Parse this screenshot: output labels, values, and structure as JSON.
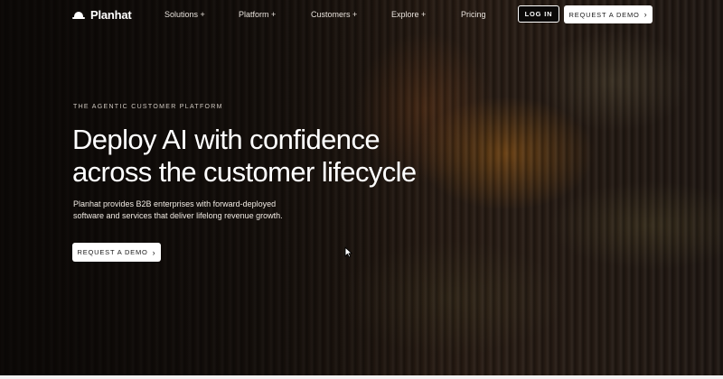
{
  "nav": {
    "brand": "Planhat",
    "items": [
      {
        "label": "Solutions +"
      },
      {
        "label": "Platform +"
      },
      {
        "label": "Customers +"
      },
      {
        "label": "Explore +"
      },
      {
        "label": "Pricing"
      }
    ],
    "login_label": "LOG IN",
    "demo_label": "REQUEST A DEMO",
    "demo_chevron": "›"
  },
  "hero": {
    "eyebrow": "THE AGENTIC CUSTOMER PLATFORM",
    "headline_line1": "Deploy AI with confidence",
    "headline_line2": "across the customer lifecycle",
    "subtext": "Planhat provides B2B enterprises with forward-deployed software and services that deliver lifelong revenue growth.",
    "cta_label": "REQUEST A DEMO",
    "cta_chevron": "›"
  },
  "icons": {
    "logo": "planhat-hat-icon",
    "chevron": "chevron-right-icon",
    "cursor": "mouse-pointer-icon"
  }
}
